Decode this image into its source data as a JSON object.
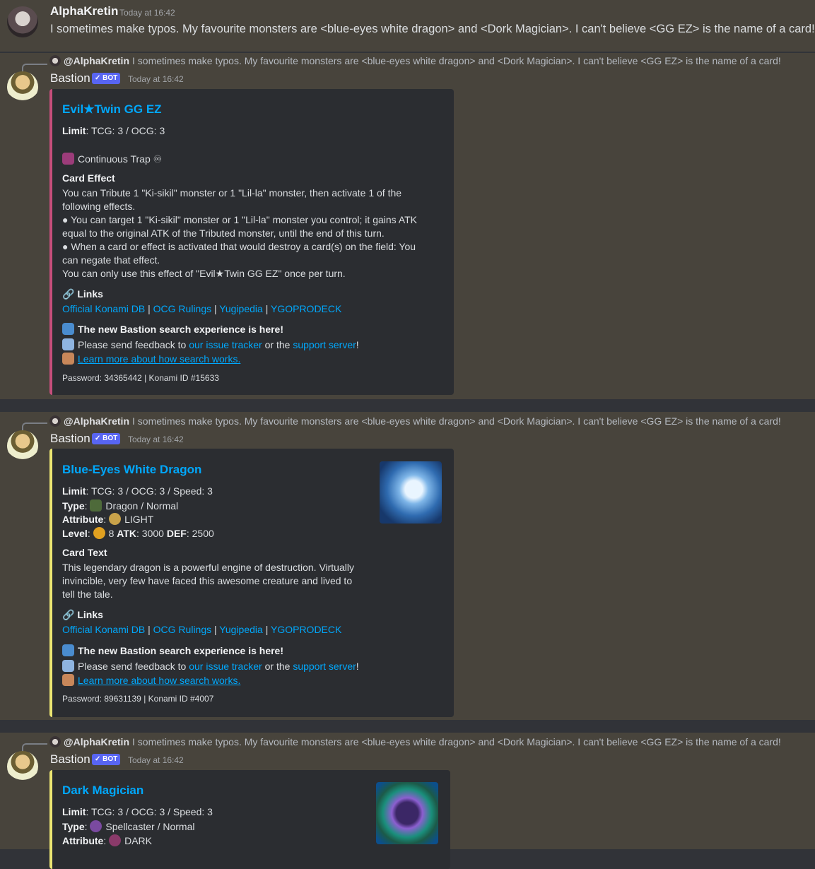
{
  "user": {
    "name": "AlphaKretin",
    "timestamp": "Today at 16:42",
    "message": "I sometimes make typos. My favourite monsters are <blue-eyes white dragon> and <Dork Magician>. I can't believe <GG EZ> is the name of a card!"
  },
  "bot": {
    "name": "Bastion",
    "badge": "✓ BOT",
    "timestamp": "Today at 16:42"
  },
  "reply": {
    "mention": "@AlphaKretin",
    "text": "I sometimes make typos. My favourite monsters are <blue-eyes white dragon> and <Dork Magician>. I can't believe <GG EZ> is the name of a card!"
  },
  "common": {
    "limit_label": "Limit",
    "type_label": "Type",
    "attribute_label": "Attribute",
    "level_label": "Level",
    "atk_label": "ATK",
    "def_label": "DEF",
    "links_heading": "Links",
    "links": [
      "Official Konami DB",
      "OCG Rulings",
      "Yugipedia",
      "YGOPRODECK"
    ],
    "link_sep": "|",
    "promo_heading": "The new Bastion search experience is here!",
    "feedback_prefix": "Please send feedback to",
    "issue_tracker": "our issue tracker",
    "or_the": "or the",
    "support_server": "support server",
    "bang": "!",
    "learn_more": "Learn more about how search works."
  },
  "cards": [
    {
      "title": "Evil★Twin GG EZ",
      "limit": "TCG: 3 / OCG: 3",
      "card_type": "Continuous Trap",
      "effect_heading": "Card Effect",
      "effect_lines": [
        "You can Tribute 1 \"Ki-sikil\" monster or 1 \"Lil-la\" monster, then activate 1 of the",
        "following effects.",
        "● You can target 1 \"Ki-sikil\" monster or 1 \"Lil-la\" monster you control; it gains ATK",
        "equal to the original ATK of the Tributed monster, until the end of this turn.",
        "● When a card or effect is activated that would destroy a card(s) on the field: You",
        "can negate that effect.",
        "You can only use this effect of \"Evil★Twin GG EZ\" once per turn."
      ],
      "footer": "Password: 34365442 | Konami ID #15633",
      "accent": "#c64e7b"
    },
    {
      "title": "Blue-Eyes White Dragon",
      "limit": "TCG: 3 / OCG: 3 / Speed: 3",
      "type": "Dragon / Normal",
      "attribute": "LIGHT",
      "level": "8",
      "atk": "3000",
      "def": "2500",
      "text_heading": "Card Text",
      "text_lines": [
        "This legendary dragon is a powerful engine of destruction. Virtually",
        "invincible, very few have faced this awesome creature and lived to",
        "tell the tale."
      ],
      "footer": "Password: 89631139 | Konami ID #4007",
      "accent": "#ebe572"
    },
    {
      "title": "Dark Magician",
      "limit": "TCG: 3 / OCG: 3 / Speed: 3",
      "type": "Spellcaster / Normal",
      "attribute": "DARK",
      "accent": "#ebe572"
    }
  ]
}
